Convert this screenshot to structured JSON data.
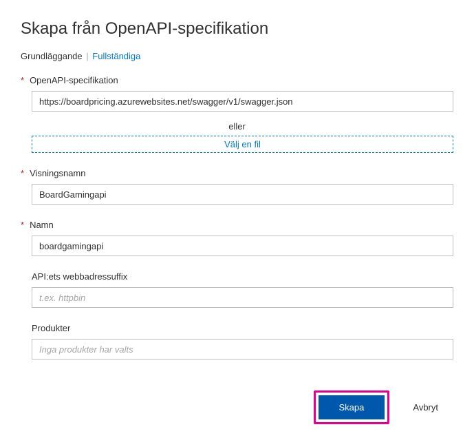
{
  "title": "Skapa från OpenAPI-specifikation",
  "tabs": {
    "basic": "Grundläggande",
    "divider": "|",
    "full": "Fullständiga"
  },
  "form": {
    "openapi_spec": {
      "label": "OpenAPI-specifikation",
      "value": "https://boardpricing.azurewebsites.net/swagger/v1/swagger.json",
      "or_text": "eller",
      "file_picker": "Välj en fil"
    },
    "display_name": {
      "label": "Visningsnamn",
      "value": "BoardGamingapi"
    },
    "name": {
      "label": "Namn",
      "value": "boardgamingapi"
    },
    "url_suffix": {
      "label": "API:ets webbadressuffix",
      "placeholder": "t.ex. httpbin"
    },
    "products": {
      "label": "Produkter",
      "placeholder": "Inga produkter har valts"
    }
  },
  "buttons": {
    "create": "Skapa",
    "cancel": "Avbryt"
  },
  "required_mark": "*"
}
